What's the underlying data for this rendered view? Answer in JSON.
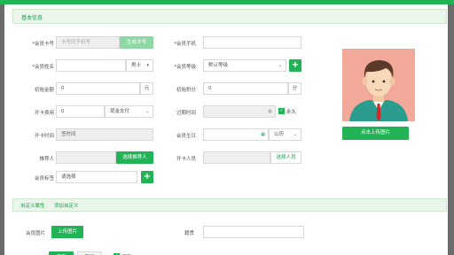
{
  "section_title": "基本信息",
  "form": {
    "card_no": {
      "label": "*会员卡号",
      "placeholder": "卡号同手机号",
      "button": "生成卡号"
    },
    "phone": {
      "label": "*会员手机",
      "value": ""
    },
    "name": {
      "label": "*会员姓名",
      "value": "",
      "gender": "男士"
    },
    "level": {
      "label": "*会员等级",
      "value": "默认等级"
    },
    "initial_amount": {
      "label": "初始金额",
      "value": "0",
      "unit": "元"
    },
    "initial_points": {
      "label": "初始积分",
      "value": "0",
      "unit": "分"
    },
    "card_fee": {
      "label": "开卡费用",
      "value": "0",
      "pay_method": "现金支付"
    },
    "expire": {
      "label": "过期时间",
      "value": "",
      "forever_label": "永久"
    },
    "card_time": {
      "label": "开卡时间",
      "value": "签时间"
    },
    "birthday": {
      "label": "会员生日",
      "value": "",
      "calendar": "公历"
    },
    "referrer": {
      "label": "推荐人",
      "value": "",
      "button": "选择推荐人"
    },
    "staff": {
      "label": "开卡人员",
      "value": "",
      "button": "选择人员"
    },
    "tags": {
      "label": "会员标签",
      "value": "请选择"
    }
  },
  "upload_button": "点击上传图片",
  "tabs": [
    "自定义属性",
    "添加自定义"
  ],
  "custom": {
    "photo_label": "会员图片",
    "photo_button": "上传图片",
    "hobby_label": "籍贯",
    "hobby_value": ""
  },
  "footer": {
    "save": "保存",
    "cancel": "取消",
    "print": "打印"
  },
  "colors": {
    "accent": "#22b357",
    "section_bg": "#eaf6ea"
  }
}
